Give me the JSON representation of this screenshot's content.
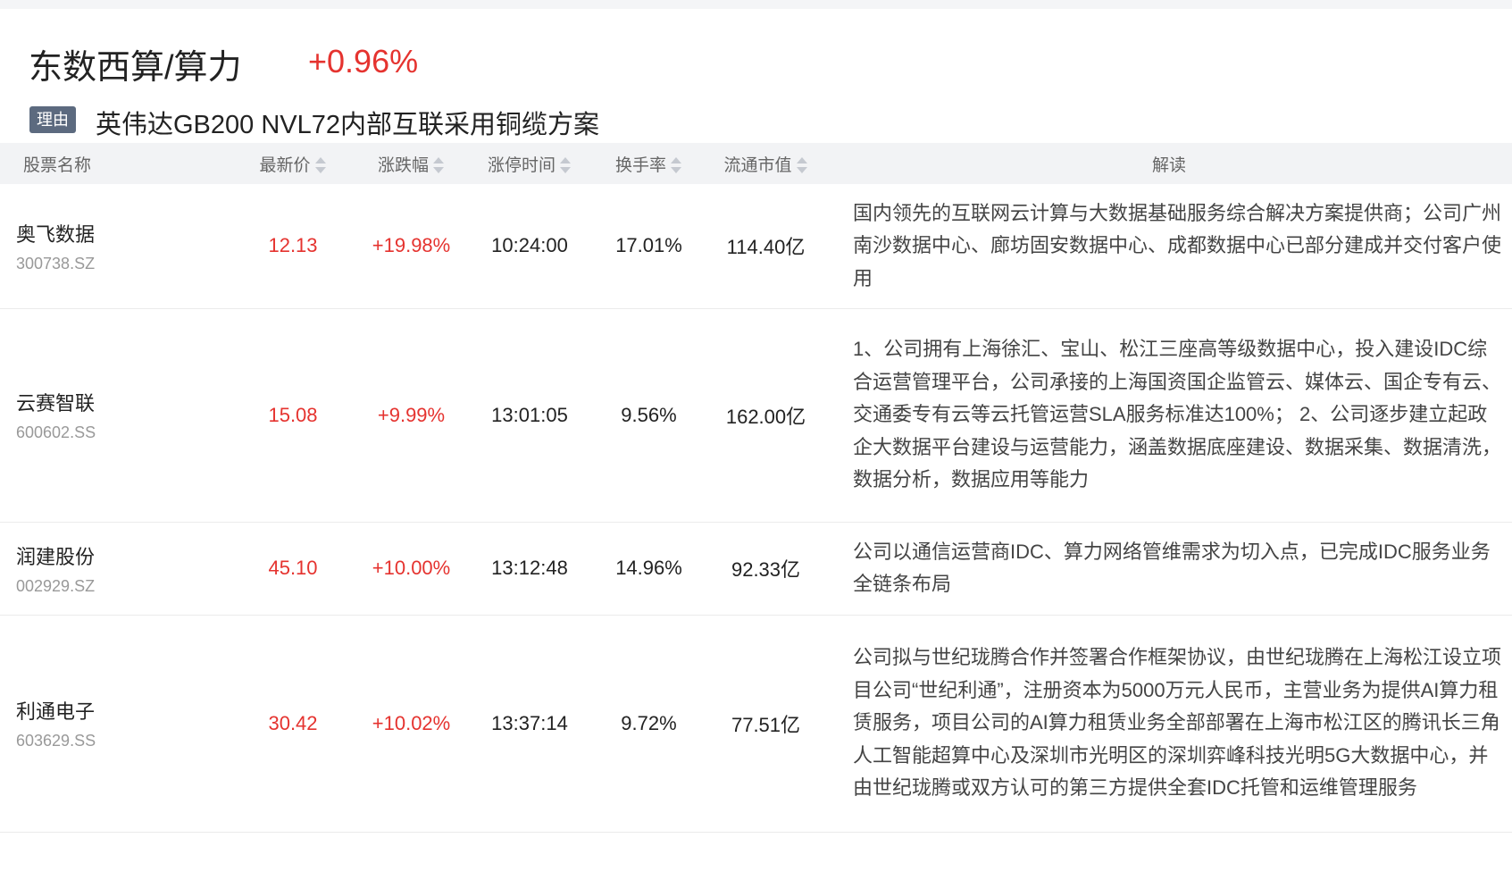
{
  "header": {
    "title": "东数西算/算力",
    "change": "+0.96%",
    "reason_badge": "理由",
    "reason_text": "英伟达GB200 NVL72内部互联采用铜缆方案"
  },
  "table": {
    "columns": [
      "股票名称",
      "最新价",
      "涨跌幅",
      "涨停时间",
      "换手率",
      "流通市值",
      "解读"
    ],
    "rows": [
      {
        "name": "奥飞数据",
        "code": "300738.SZ",
        "price": "12.13",
        "change": "+19.98%",
        "limit_time": "10:24:00",
        "turnover": "17.01%",
        "market_cap": "114.40亿",
        "desc": "国内领先的互联网云计算与大数据基础服务综合解决方案提供商；公司广州南沙数据中心、廊坊固安数据中心、成都数据中心已部分建成并交付客户使用"
      },
      {
        "name": "云赛智联",
        "code": "600602.SS",
        "price": "15.08",
        "change": "+9.99%",
        "limit_time": "13:01:05",
        "turnover": "9.56%",
        "market_cap": "162.00亿",
        "desc": "1、公司拥有上海徐汇、宝山、松江三座高等级数据中心，投入建设IDC综合运营管理平台，公司承接的上海国资国企监管云、媒体云、国企专有云、交通委专有云等云托管运营SLA服务标准达100%； 2、公司逐步建立起政企大数据平台建设与运营能力，涵盖数据底座建设、数据采集、数据清洗，数据分析，数据应用等能力"
      },
      {
        "name": "润建股份",
        "code": "002929.SZ",
        "price": "45.10",
        "change": "+10.00%",
        "limit_time": "13:12:48",
        "turnover": "14.96%",
        "market_cap": "92.33亿",
        "desc": "公司以通信运营商IDC、算力网络管维需求为切入点，已完成IDC服务业务全链条布局"
      },
      {
        "name": "利通电子",
        "code": "603629.SS",
        "price": "30.42",
        "change": "+10.02%",
        "limit_time": "13:37:14",
        "turnover": "9.72%",
        "market_cap": "77.51亿",
        "desc": "公司拟与世纪珑腾合作并签署合作框架协议，由世纪珑腾在上海松江设立项目公司“世纪利通”，注册资本为5000万元人民币，主营业务为提供AI算力租赁服务，项目公司的AI算力租赁业务全部部署在上海市松江区的腾讯长三角人工智能超算中心及深圳市光明区的深圳弈峰科技光明5G大数据中心，并由世纪珑腾或双方认可的第三方提供全套IDC托管和运维管理服务"
      }
    ]
  },
  "colors": {
    "accent_red": "#e5332f",
    "badge_bg": "#5c6a7f",
    "header_bg": "#f2f3f5"
  },
  "icons": {
    "sort": "sort-updown-icon"
  }
}
